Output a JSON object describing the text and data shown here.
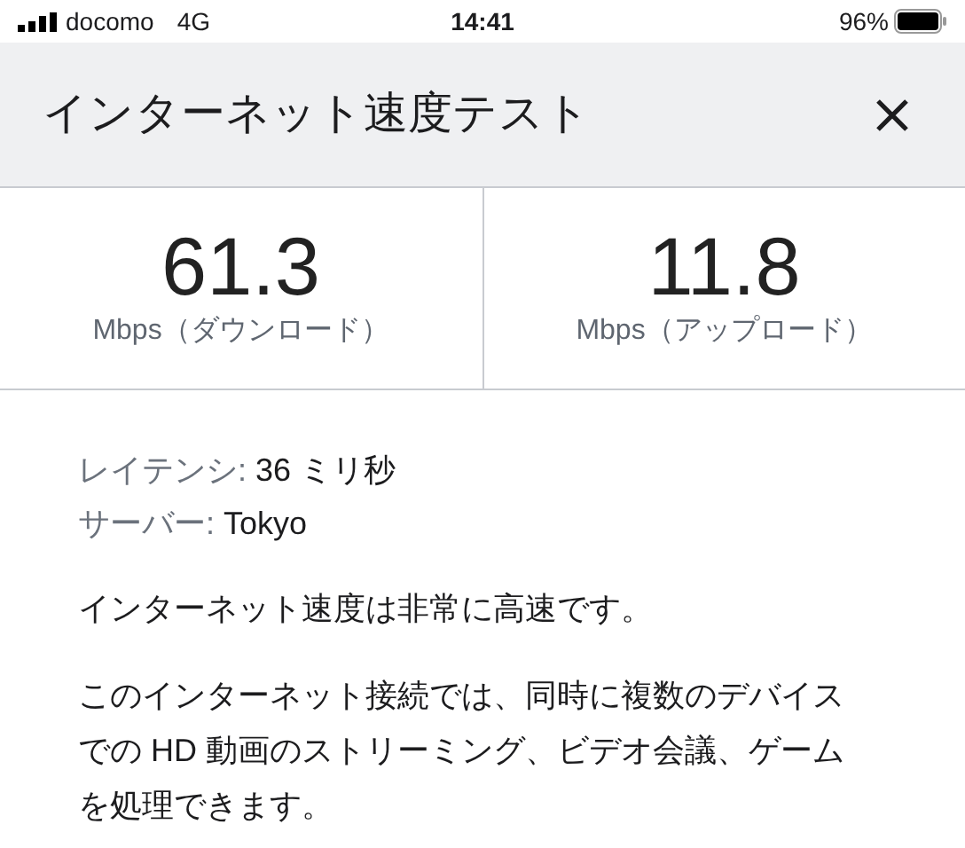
{
  "status_bar": {
    "carrier": "docomo",
    "network": "4G",
    "time": "14:41",
    "battery": "96%"
  },
  "header": {
    "title": "インターネット速度テスト"
  },
  "results": [
    {
      "value": "61.3",
      "unit": "Mbps（ダウンロード）"
    },
    {
      "value": "11.8",
      "unit": "Mbps（アップロード）"
    }
  ],
  "details": [
    {
      "label": "レイテンシ:",
      "value": "36 ミリ秒"
    },
    {
      "label": "サーバー:",
      "value": "Tokyo"
    }
  ],
  "paragraphs": [
    "インターネット速度は非常に高速です。",
    "このインターネット接続では、同時に複数のデバイスでの HD 動画のストリーミング、ビデオ会議、ゲームを処理できます。"
  ]
}
